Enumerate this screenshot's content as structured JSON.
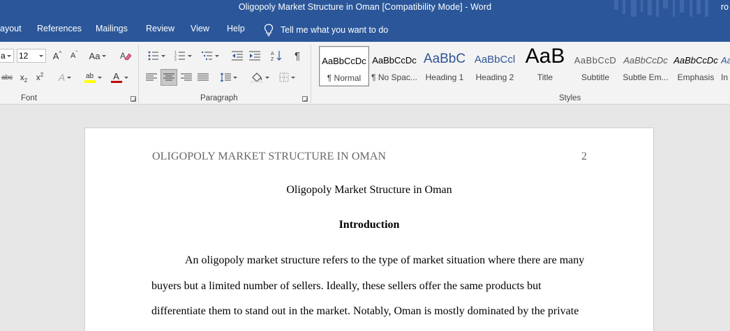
{
  "window": {
    "title": "Oligopoly Market Structure in Oman [Compatibility Mode]  -  Word",
    "user_fragment": "ro"
  },
  "tabs": [
    "ayout",
    "References",
    "Mailings",
    "Review",
    "View",
    "Help"
  ],
  "tell_me": "Tell me what you want to do",
  "font": {
    "font_name_value": "a",
    "font_size_value": "12",
    "grow_glyph": "A",
    "shrink_glyph": "A",
    "case_glyph": "Aa",
    "strike_glyph": "abc",
    "sub_glyph": "x",
    "sub_mark": "2",
    "sup_glyph": "x",
    "sup_mark": "2",
    "effects_glyph": "A",
    "highlight_glyph": "ab",
    "font_color_glyph": "A",
    "label": "Font"
  },
  "paragraph": {
    "label": "Paragraph",
    "sort_glyph": "A",
    "pilcrow_glyph": "¶"
  },
  "styles": {
    "label": "Styles",
    "items": [
      {
        "sample": "AaBbCcDc",
        "name": "¶ Normal"
      },
      {
        "sample": "AaBbCcDc",
        "name": "¶ No Spac..."
      },
      {
        "sample": "AaBbC",
        "name": "Heading 1"
      },
      {
        "sample": "AaBbCcl",
        "name": "Heading 2"
      },
      {
        "sample": "AaB",
        "name": "Title"
      },
      {
        "sample": "AaBbCcD",
        "name": "Subtitle"
      },
      {
        "sample": "AaBbCcDc",
        "name": "Subtle Em..."
      },
      {
        "sample": "AaBbCcDc",
        "name": "Emphasis"
      },
      {
        "sample": "AaBbCcDc",
        "name": "In"
      }
    ],
    "colors": {
      "heading": "#2f5496",
      "subtle": "#595959"
    }
  },
  "document": {
    "header_title": "OLIGOPOLY MARKET STRUCTURE IN OMAN",
    "page_number": "2",
    "title": "Oligopoly Market Structure in Oman",
    "heading": "Introduction",
    "lines": [
      "An oligopoly market structure refers to the type of market situation where there are many",
      "buyers but a limited number of sellers. Ideally, these sellers offer the same products but",
      "differentiate them to stand out in the market. Notably, Oman is mostly dominated by the private"
    ]
  },
  "colors": {
    "ribbon_blue": "#2b579a",
    "font_color_red": "#c00000",
    "highlight_yellow": "#ffff00"
  }
}
